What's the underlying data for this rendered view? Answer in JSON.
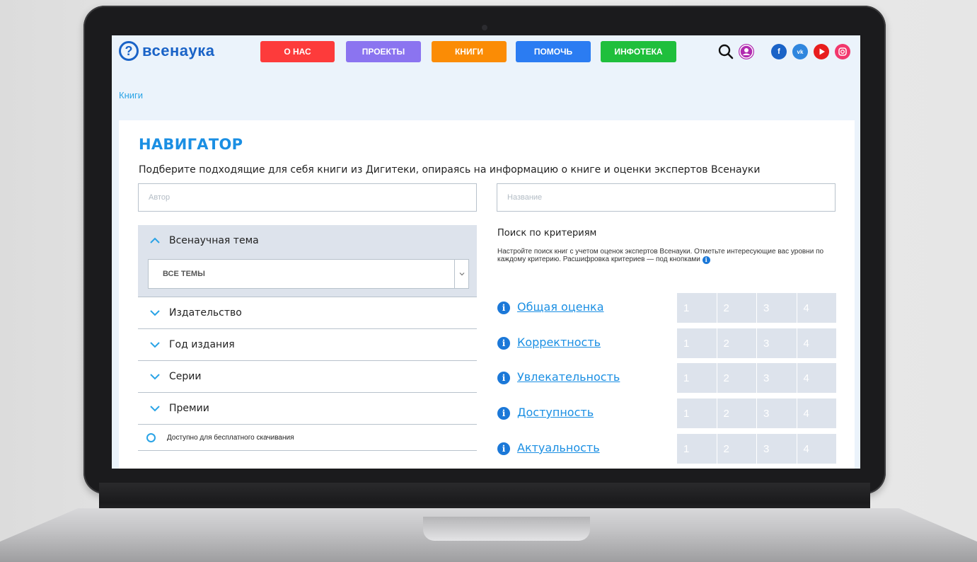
{
  "logo": {
    "mark": "?",
    "text": "всенаука"
  },
  "nav": [
    {
      "label": "О НАС",
      "color": "#fd3b3b"
    },
    {
      "label": "ПРОЕКТЫ",
      "color": "#8b74f0"
    },
    {
      "label": "КНИГИ",
      "color": "#fb8c05"
    },
    {
      "label": "ПОМОЧЬ",
      "color": "#2b7cf2"
    },
    {
      "label": "ИНФОТЕКА",
      "color": "#1fbf3c"
    }
  ],
  "header_icons": [
    "search-icon",
    "user-icon",
    "facebook-icon",
    "vk-icon",
    "youtube-icon",
    "instagram-icon"
  ],
  "social": {
    "facebook": "f",
    "vk": "vk"
  },
  "breadcrumb": "Книги",
  "page": {
    "title": "НАВИГАТОР",
    "subtitle": "Подберите подходящие для себя книги из Дигитеки, опираясь на информацию о книге и оценки экспертов Всенауки"
  },
  "inputs": {
    "author_placeholder": "Автор",
    "title_placeholder": "Название"
  },
  "filters": {
    "topic": {
      "label": "Всенаучная тема",
      "selected": "ВСЕ ТЕМЫ"
    },
    "items": [
      "Издательство",
      "Год издания",
      "Серии",
      "Премии"
    ],
    "free_download": "Доступно для бесплатного скачивания"
  },
  "criteria": {
    "title": "Поиск по критериям",
    "description": "Настройте поиск книг с учетом оценок экспертов Всенауки. Отметьте интересующие вас уровни по каждому критерию. Расшифровка критериев — под кнопками",
    "info_glyph": "i",
    "levels": [
      "1",
      "2",
      "3",
      "4"
    ],
    "items": [
      "Общая оценка",
      "Корректность",
      "Увлекательность",
      "Доступность",
      "Актуальность"
    ]
  },
  "colors": {
    "accent": "#1b8fe3",
    "brand": "#1a63c7",
    "level_bg": "#dde3ec",
    "screen_bg": "#ebf3fb"
  }
}
